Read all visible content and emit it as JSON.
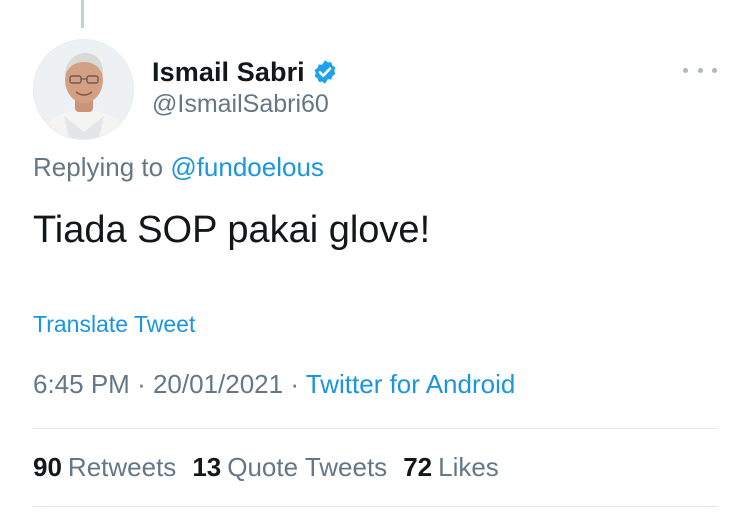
{
  "tweet": {
    "author": {
      "display_name": "Ismail Sabri",
      "handle": "@IsmailSabri60",
      "verified": true,
      "avatar_icon": "profile-photo"
    },
    "replying_prefix": "Replying to",
    "replying_to": "@fundoelous",
    "text": "Tiada SOP pakai glove!",
    "translate_label": "Translate Tweet",
    "time": "6:45 PM",
    "date": "20/01/2021",
    "separator": "·",
    "source": "Twitter for Android",
    "stats": {
      "retweets_count": "90",
      "retweets_label": "Retweets",
      "quote_tweets_count": "13",
      "quote_tweets_label": "Quote Tweets",
      "likes_count": "72",
      "likes_label": "Likes"
    }
  },
  "colors": {
    "link": "#1b95e0",
    "secondary_text": "#657786",
    "primary_text": "#14171a",
    "verified_badge": "#1da1f2",
    "divider": "#e1e8ed"
  }
}
